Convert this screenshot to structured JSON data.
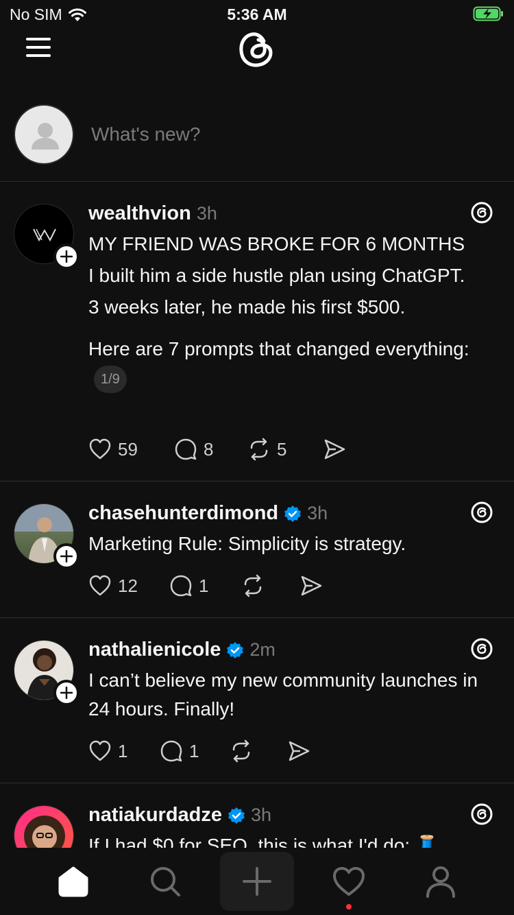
{
  "status": {
    "carrier": "No SIM",
    "time": "5:36 AM"
  },
  "composer": {
    "placeholder": "What's new?"
  },
  "posts": [
    {
      "username": "wealthvion",
      "verified": false,
      "time": "3h",
      "lines": [
        "MY FRIEND WAS BROKE FOR 6 MONTHS",
        "I built him a side hustle plan using ChatGPT.",
        "3 weeks later, he made his first $500.",
        "Here are 7 prompts that changed everything:"
      ],
      "pager": "1/9",
      "likes": "59",
      "replies": "8",
      "reposts": "5"
    },
    {
      "username": "chasehunterdimond",
      "verified": true,
      "time": "3h",
      "lines": [
        "Marketing Rule: Simplicity is strategy."
      ],
      "likes": "12",
      "replies": "1",
      "reposts": ""
    },
    {
      "username": "nathalienicole",
      "verified": true,
      "time": "2m",
      "lines": [
        "I can’t believe my new community launches in 24 hours. Finally!"
      ],
      "likes": "1",
      "replies": "1",
      "reposts": ""
    },
    {
      "username": "natiakurdadze",
      "verified": true,
      "time": "3h",
      "lines": [
        "If I had $0 for SEO, this is what I'd do: 🧵"
      ]
    }
  ],
  "nav": {
    "items": [
      "home-icon",
      "search-icon",
      "create-icon",
      "heart-icon",
      "profile-icon"
    ],
    "active": "home",
    "notification_dot_color": "#ff3040"
  },
  "colors": {
    "background": "#101010",
    "verified": "#0095f6",
    "muted": "#7a7a7a",
    "divider": "#2e2e2e"
  }
}
